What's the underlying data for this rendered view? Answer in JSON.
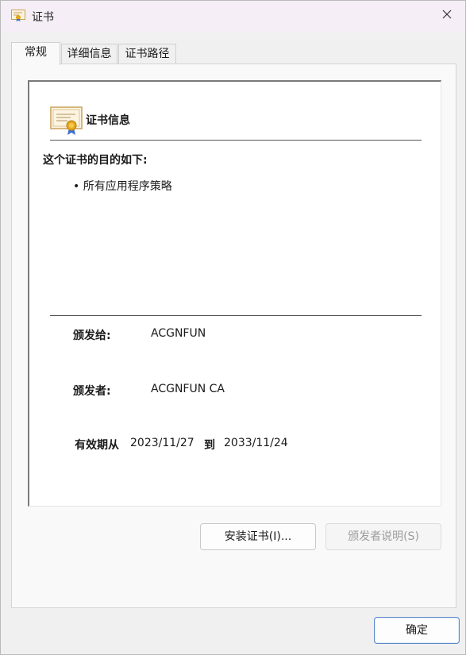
{
  "window": {
    "title": "证书"
  },
  "tabs": [
    {
      "label": "常规"
    },
    {
      "label": "详细信息"
    },
    {
      "label": "证书路径"
    }
  ],
  "cert_info": {
    "heading": "证书信息",
    "purpose_heading": "这个证书的目的如下:",
    "purposes": [
      "所有应用程序策略"
    ],
    "issued_to_label": "颁发给:",
    "issued_to_value": "ACGNFUN",
    "issued_by_label": "颁发者:",
    "issued_by_value": "ACGNFUN CA",
    "valid_from_label": "有效期从",
    "valid_from": "2023/11/27",
    "valid_to_label": "到",
    "valid_to": "2033/11/24"
  },
  "buttons": {
    "install": "安装证书(I)...",
    "issuer_statement": "颁发者说明(S)",
    "ok": "确定"
  },
  "icons": {
    "title": "certificate-icon",
    "close": "close-icon",
    "cert": "certificate-icon"
  }
}
